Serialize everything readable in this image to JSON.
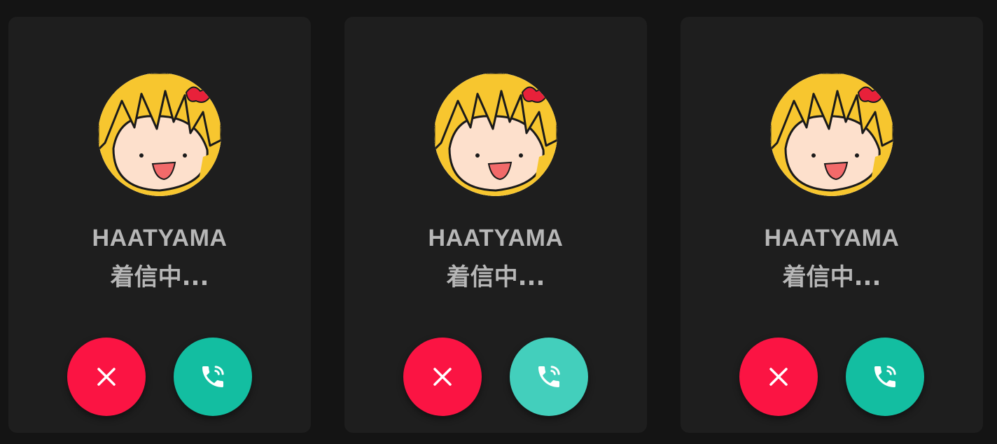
{
  "calls": [
    {
      "caller_name": "HAATYAMA",
      "status_text": "着信中...",
      "decline_icon": "close-icon",
      "accept_icon": "phone-ringing-icon",
      "decline_color": "#fb1443",
      "accept_color": "#13bea1"
    },
    {
      "caller_name": "HAATYAMA",
      "status_text": "着信中...",
      "decline_icon": "close-icon",
      "accept_icon": "phone-ringing-icon",
      "decline_color": "#fb1443",
      "accept_color": "#43cfbc",
      "accept_state": "hover"
    },
    {
      "caller_name": "HAATYAMA",
      "status_text": "着信中...",
      "decline_icon": "close-icon",
      "accept_icon": "phone-ringing-icon",
      "decline_color": "#fb1443",
      "accept_color": "#13bea1"
    }
  ],
  "colors": {
    "page_background": "#141414",
    "card_background": "#1e1e1e",
    "text": "#b7b7b7"
  }
}
